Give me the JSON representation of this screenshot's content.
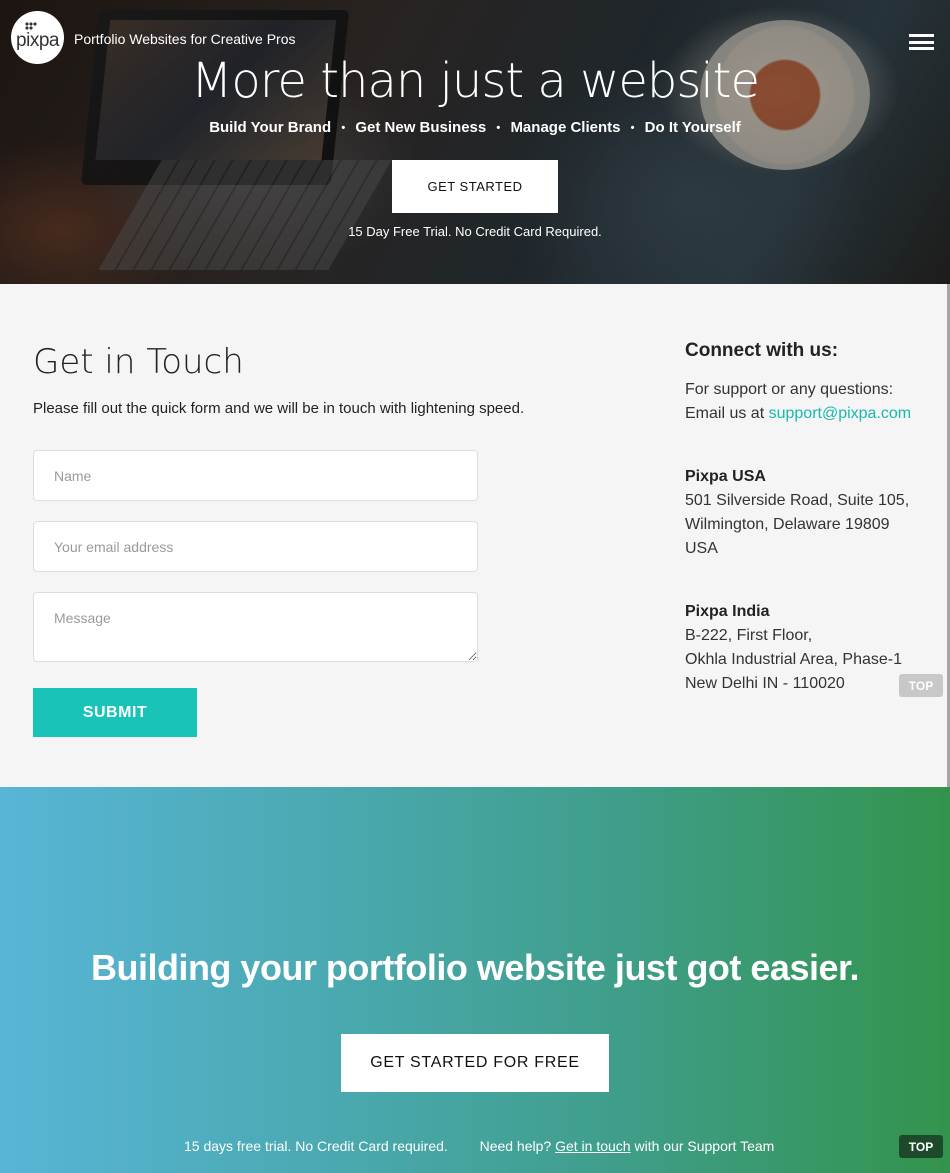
{
  "header": {
    "logo_text": "pixpa",
    "tagline": "Portfolio Websites for Creative Pros",
    "menu_icon": "hamburger-menu-icon"
  },
  "hero": {
    "title": "More than just a website",
    "features": [
      "Build Your Brand",
      "Get New Business",
      "Manage Clients",
      "Do It Yourself"
    ],
    "separator": "•",
    "cta_label": "GET STARTED",
    "note": "15 Day Free Trial. No Credit Card Required."
  },
  "contact": {
    "title": "Get in Touch",
    "lead": "Please fill out the quick form and we will be in touch with lightening speed.",
    "name_placeholder": "Name",
    "email_placeholder": "Your email address",
    "message_placeholder": "Message",
    "submit_label": "SUBMIT"
  },
  "connect": {
    "title": "Connect with us:",
    "support_line": "For support or any questions:",
    "email_prefix": "Email us at",
    "email": "support@pixpa.com",
    "usa": {
      "name": "Pixpa USA",
      "line1": "501 Silverside Road, Suite 105,",
      "line2": "Wilmington, Delaware 19809",
      "line3": "USA"
    },
    "india": {
      "name": "Pixpa India",
      "line1": "B-222, First Floor,",
      "line2": "Okhla Industrial Area, Phase-1",
      "line3": "New Delhi IN - 110020"
    }
  },
  "top_label": "TOP",
  "banner": {
    "title": "Building your portfolio website just got easier.",
    "cta_label": "GET STARTED FOR FREE",
    "trial_note": "15 days free trial. No Credit Card required.",
    "help_prefix": "Need help?",
    "help_link": "Get in touch",
    "help_suffix": "with our Support Team"
  },
  "colors": {
    "accent_teal": "#19c3b7",
    "link_teal": "#19b8ad",
    "banner_left": "#58b5d6",
    "banner_right": "#33934d"
  }
}
